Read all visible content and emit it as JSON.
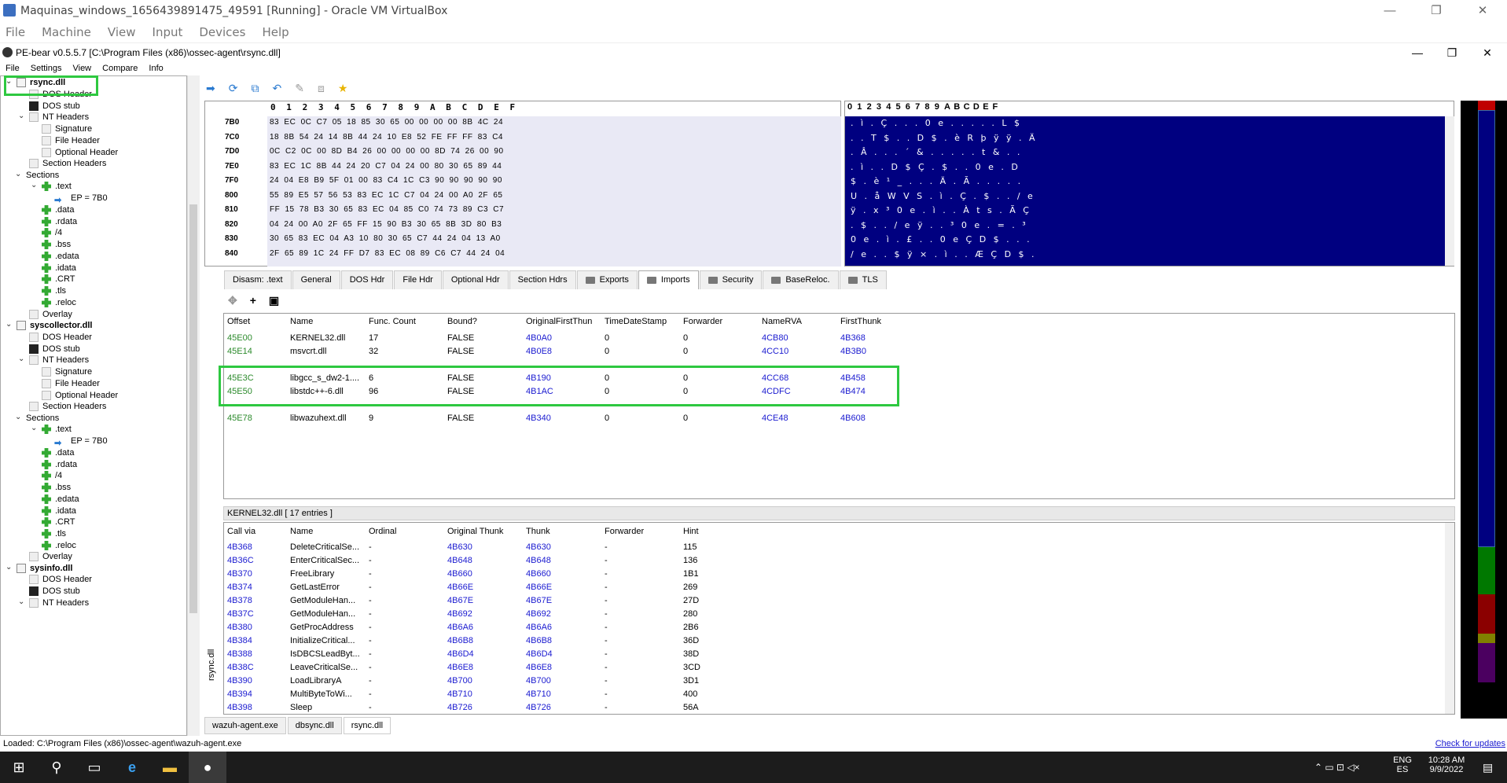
{
  "vbox": {
    "title": "Maquinas_windows_1656439891475_49591 [Running] - Oracle VM VirtualBox",
    "menu": [
      "File",
      "Machine",
      "View",
      "Input",
      "Devices",
      "Help"
    ]
  },
  "pebear": {
    "title": "PE-bear v0.5.5.7 [C:\\Program Files (x86)\\ossec-agent\\rsync.dll]",
    "menu": [
      "File",
      "Settings",
      "View",
      "Compare",
      "Info"
    ]
  },
  "tree": [
    {
      "label": "rsync.dll",
      "kind": "dll"
    },
    {
      "label": "DOS Header",
      "kind": "doc"
    },
    {
      "label": "DOS stub",
      "kind": "blk"
    },
    {
      "label": "NT Headers",
      "kind": "doc"
    },
    {
      "label": "Signature",
      "kind": "gry"
    },
    {
      "label": "File Header",
      "kind": "gry"
    },
    {
      "label": "Optional Header",
      "kind": "gry"
    },
    {
      "label": "Section Headers",
      "kind": "gry"
    },
    {
      "label": "Sections",
      "kind": "none"
    },
    {
      "label": ".text",
      "kind": "grn"
    },
    {
      "label": "EP = 7B0",
      "kind": "arr"
    },
    {
      "label": ".data",
      "kind": "grn"
    },
    {
      "label": ".rdata",
      "kind": "grn"
    },
    {
      "label": "/4",
      "kind": "grn"
    },
    {
      "label": ".bss",
      "kind": "grn"
    },
    {
      "label": ".edata",
      "kind": "grn"
    },
    {
      "label": ".idata",
      "kind": "grn"
    },
    {
      "label": ".CRT",
      "kind": "grn"
    },
    {
      "label": ".tls",
      "kind": "grn"
    },
    {
      "label": ".reloc",
      "kind": "grn"
    },
    {
      "label": "Overlay",
      "kind": "gry"
    },
    {
      "label": "syscollector.dll",
      "kind": "dll"
    },
    {
      "label": "DOS Header",
      "kind": "doc"
    },
    {
      "label": "DOS stub",
      "kind": "blk"
    },
    {
      "label": "NT Headers",
      "kind": "doc"
    },
    {
      "label": "Signature",
      "kind": "gry"
    },
    {
      "label": "File Header",
      "kind": "gry"
    },
    {
      "label": "Optional Header",
      "kind": "gry"
    },
    {
      "label": "Section Headers",
      "kind": "gry"
    },
    {
      "label": "Sections",
      "kind": "none"
    },
    {
      "label": ".text",
      "kind": "grn"
    },
    {
      "label": "EP = 7B0",
      "kind": "arr"
    },
    {
      "label": ".data",
      "kind": "grn"
    },
    {
      "label": ".rdata",
      "kind": "grn"
    },
    {
      "label": "/4",
      "kind": "grn"
    },
    {
      "label": ".bss",
      "kind": "grn"
    },
    {
      "label": ".edata",
      "kind": "grn"
    },
    {
      "label": ".idata",
      "kind": "grn"
    },
    {
      "label": ".CRT",
      "kind": "grn"
    },
    {
      "label": ".tls",
      "kind": "grn"
    },
    {
      "label": ".reloc",
      "kind": "grn"
    },
    {
      "label": "Overlay",
      "kind": "gry"
    },
    {
      "label": "sysinfo.dll",
      "kind": "dll"
    },
    {
      "label": "DOS Header",
      "kind": "doc"
    },
    {
      "label": "DOS stub",
      "kind": "blk"
    },
    {
      "label": "NT Headers",
      "kind": "doc"
    }
  ],
  "hex": {
    "header": [
      "0",
      "1",
      "2",
      "3",
      "4",
      "5",
      "6",
      "7",
      "8",
      "9",
      "A",
      "B",
      "C",
      "D",
      "E",
      "F"
    ],
    "rows": [
      {
        "addr": "7B0",
        "bytes": "83 EC 0C C7 05 18 85 30 65 00 00 00 00 8B 4C 24",
        "ascii": ". ì . Ç . . . 0 e . . . . . L $"
      },
      {
        "addr": "7C0",
        "bytes": "18 8B 54 24 14 8B 44 24 10 E8 52 FE FF FF 83 C4",
        "ascii": ". . T $ . . D $ . è R þ ÿ ÿ . Ä"
      },
      {
        "addr": "7D0",
        "bytes": "0C C2 0C 00 8D B4 26 00 00 00 00 8D 74 26 00 90",
        "ascii": ". Â . . . ´ & . . . . . t & . ."
      },
      {
        "addr": "7E0",
        "bytes": "83 EC 1C 8B 44 24 20 C7 04 24 00 80 30 65 89 44",
        "ascii": ". ì . . D $   Ç . $ . . 0 e . D"
      },
      {
        "addr": "7F0",
        "bytes": "24 04 E8 B9 5F 01 00 83 C4 1C C3 90 90 90 90 90",
        "ascii": "$ . è ¹ _ . . . Ä . Ã . . . . ."
      },
      {
        "addr": "800",
        "bytes": "55 89 E5 57 56 53 83 EC 1C C7 04 24 00 A0 2F 65",
        "ascii": "U . å W V S . ì . Ç . $ . . / e"
      },
      {
        "addr": "810",
        "bytes": "FF 15 78 B3 30 65 83 EC 04 85 C0 74 73 89 C3 C7",
        "ascii": "ÿ . x ³ 0 e . ì . . À t s . Ã Ç"
      },
      {
        "addr": "820",
        "bytes": "04 24 00 A0 2F 65 FF 15 90 B3 30 65 8B 3D 80 B3",
        "ascii": ". $ . . / e ÿ . . ³ 0 e . = . ³"
      },
      {
        "addr": "830",
        "bytes": "30 65 83 EC 04 A3 10 80 30 65 C7 44 24 04 13 A0",
        "ascii": "0 e . ì . £ . . 0 e Ç D $ . . ."
      },
      {
        "addr": "840",
        "bytes": "2F 65 89 1C 24 FF D7 83 EC 08 89 C6 C7 44 24 04",
        "ascii": "/ e . . $ ÿ × . ì . . Æ Ç D $ ."
      }
    ]
  },
  "tabs": [
    {
      "label": "Disasm: .text",
      "folder": false,
      "active": false
    },
    {
      "label": "General",
      "folder": false,
      "active": false
    },
    {
      "label": "DOS Hdr",
      "folder": false,
      "active": false
    },
    {
      "label": "File Hdr",
      "folder": false,
      "active": false
    },
    {
      "label": "Optional Hdr",
      "folder": false,
      "active": false
    },
    {
      "label": "Section Hdrs",
      "folder": false,
      "active": false
    },
    {
      "label": "Exports",
      "folder": true,
      "active": false
    },
    {
      "label": "Imports",
      "folder": true,
      "active": true
    },
    {
      "label": "Security",
      "folder": true,
      "active": false
    },
    {
      "label": "BaseReloc.",
      "folder": true,
      "active": false
    },
    {
      "label": "TLS",
      "folder": true,
      "active": false
    }
  ],
  "imports": {
    "columns": [
      "Offset",
      "Name",
      "Func. Count",
      "Bound?",
      "OriginalFirstThun",
      "TimeDateStamp",
      "Forwarder",
      "NameRVA",
      "FirstThunk"
    ],
    "rows": [
      [
        "45E00",
        "KERNEL32.dll",
        "17",
        "FALSE",
        "4B0A0",
        "0",
        "0",
        "4CB80",
        "4B368"
      ],
      [
        "45E14",
        "msvcrt.dll",
        "32",
        "FALSE",
        "4B0E8",
        "0",
        "0",
        "4CC10",
        "4B3B0"
      ],
      [
        "45E3C",
        "libgcc_s_dw2-1....",
        "6",
        "FALSE",
        "4B190",
        "0",
        "0",
        "4CC68",
        "4B458"
      ],
      [
        "45E50",
        "libstdc++-6.dll",
        "96",
        "FALSE",
        "4B1AC",
        "0",
        "0",
        "4CDFC",
        "4B474"
      ],
      [
        "45E78",
        "libwazuhext.dll",
        "9",
        "FALSE",
        "4B340",
        "0",
        "0",
        "4CE48",
        "4B608"
      ]
    ]
  },
  "lower": {
    "header": "KERNEL32.dll  [ 17 entries ]",
    "columns": [
      "Call via",
      "Name",
      "Ordinal",
      "Original Thunk",
      "Thunk",
      "Forwarder",
      "Hint"
    ],
    "rows": [
      [
        "4B368",
        "DeleteCriticalSe...",
        "-",
        "4B630",
        "4B630",
        "-",
        "115"
      ],
      [
        "4B36C",
        "EnterCriticalSec...",
        "-",
        "4B648",
        "4B648",
        "-",
        "136"
      ],
      [
        "4B370",
        "FreeLibrary",
        "-",
        "4B660",
        "4B660",
        "-",
        "1B1"
      ],
      [
        "4B374",
        "GetLastError",
        "-",
        "4B66E",
        "4B66E",
        "-",
        "269"
      ],
      [
        "4B378",
        "GetModuleHan...",
        "-",
        "4B67E",
        "4B67E",
        "-",
        "27D"
      ],
      [
        "4B37C",
        "GetModuleHan...",
        "-",
        "4B692",
        "4B692",
        "-",
        "280"
      ],
      [
        "4B380",
        "GetProcAddress",
        "-",
        "4B6A6",
        "4B6A6",
        "-",
        "2B6"
      ],
      [
        "4B384",
        "InitializeCritical...",
        "-",
        "4B6B8",
        "4B6B8",
        "-",
        "36D"
      ],
      [
        "4B388",
        "IsDBCSLeadByt...",
        "-",
        "4B6D4",
        "4B6D4",
        "-",
        "38D"
      ],
      [
        "4B38C",
        "LeaveCriticalSe...",
        "-",
        "4B6E8",
        "4B6E8",
        "-",
        "3CD"
      ],
      [
        "4B390",
        "LoadLibraryA",
        "-",
        "4B700",
        "4B700",
        "-",
        "3D1"
      ],
      [
        "4B394",
        "MultiByteToWi...",
        "-",
        "4B710",
        "4B710",
        "-",
        "400"
      ],
      [
        "4B398",
        "Sleep",
        "-",
        "4B726",
        "4B726",
        "-",
        "56A"
      ]
    ]
  },
  "vertical_label": "rsync.dll",
  "file_tabs": [
    "wazuh-agent.exe",
    "dbsync.dll",
    "rsync.dll"
  ],
  "status": "Loaded: C:\\Program Files (x86)\\ossec-agent\\wazuh-agent.exe",
  "check_updates": "Check for updates",
  "taskbar": {
    "lang1": "ENG",
    "lang2": "ES",
    "time": "10:28 AM",
    "date": "9/9/2022"
  },
  "colors": {
    "highlight": "#2ec840",
    "ascii_bg": "#000080",
    "link": "#1a1ad0",
    "offset": "#2b8a2b"
  }
}
